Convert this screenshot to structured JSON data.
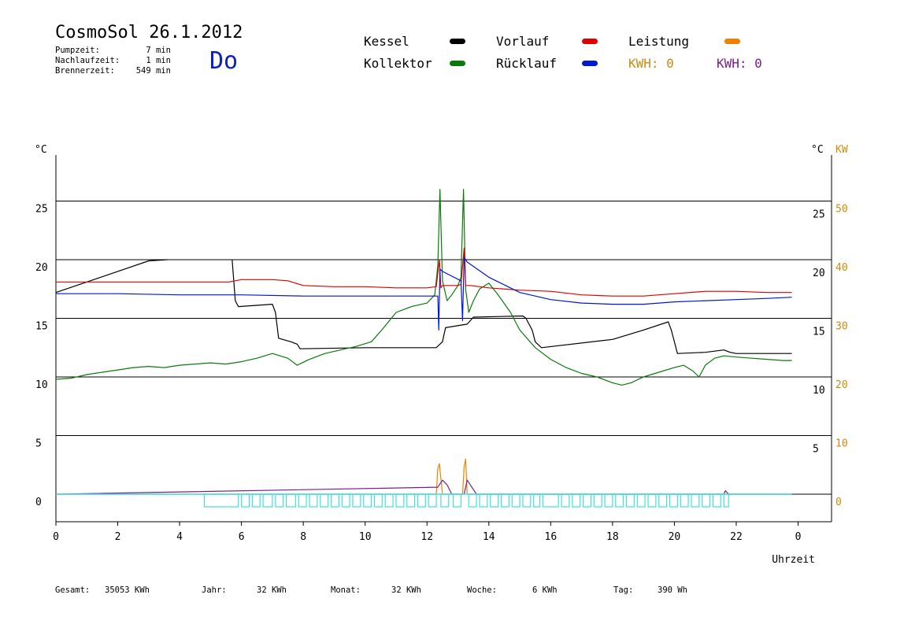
{
  "header": {
    "title": "CosmoSol 26.1.2012",
    "day": "Do",
    "stats": [
      {
        "label": "Pumpzeit:",
        "value": "7 min"
      },
      {
        "label": "Nachlaufzeit:",
        "value": "1 min"
      },
      {
        "label": "Brennerzeit:",
        "value": "549 min"
      }
    ]
  },
  "legend": {
    "kessel": "Kessel",
    "kollektor": "Kollektor",
    "vorlauf": "Vorlauf",
    "ruecklauf": "Rücklauf",
    "leistung": "Leistung",
    "kwh_orange": "KWH: 0",
    "kwh_purple": "KWH: 0"
  },
  "colors": {
    "kessel": "#000000",
    "kollektor": "#0a7a0a",
    "vorlauf": "#e00000",
    "ruecklauf": "#0018d0",
    "leistung": "#f08000",
    "purple": "#7a1e8e",
    "cyan": "#40e0e0",
    "orange_axis": "#d08a10"
  },
  "footer": [
    {
      "label": "Gesamt:",
      "value": "35053 KWh"
    },
    {
      "label": "Jahr:",
      "value": "32 KWh"
    },
    {
      "label": "Monat:",
      "value": "32 KWh"
    },
    {
      "label": "Woche:",
      "value": "6 KWh"
    },
    {
      "label": "Tag:",
      "value": "390 Wh"
    }
  ],
  "chart_data": {
    "type": "line",
    "xlabel": "Uhrzeit",
    "x_ticks": [
      "0",
      "2",
      "4",
      "6",
      "8",
      "10",
      "12",
      "14",
      "16",
      "18",
      "20",
      "22",
      "0"
    ],
    "xlim": [
      0,
      24
    ],
    "left_axis": {
      "unit": "°C",
      "ticks": [
        0,
        5,
        10,
        15,
        20,
        25
      ],
      "ylim": [
        -2.3,
        29
      ]
    },
    "right_axis": {
      "unit": "°C",
      "unit2": "KW",
      "ticks_c": [
        5,
        10,
        15,
        20,
        25
      ],
      "ticks_kw": [
        0,
        10,
        20,
        30,
        40,
        50
      ]
    },
    "series": [
      {
        "name": "Kessel",
        "color_key": "kessel",
        "x": [
          0,
          1,
          2,
          3,
          3.6,
          3.6,
          5.7,
          5.8,
          5.9,
          7.0,
          7.1,
          7.2,
          7.6,
          7.8,
          7.9,
          10,
          12.3,
          12.5,
          12.6,
          13.3,
          13.5,
          15.1,
          15.2,
          15.4,
          15.5,
          15.7,
          18,
          19,
          19.8,
          19.9,
          20.1,
          21,
          21.6,
          21.8,
          22,
          23.8
        ],
        "y": [
          17.2,
          18.1,
          19.0,
          19.9,
          20.0,
          null,
          20.0,
          16.5,
          16.0,
          16.2,
          15.5,
          13.3,
          13.0,
          12.8,
          12.4,
          12.5,
          12.5,
          13.0,
          14.2,
          14.5,
          15.1,
          15.2,
          15.0,
          14.0,
          13.0,
          12.5,
          13.2,
          14.0,
          14.7,
          14.0,
          12.0,
          12.1,
          12.3,
          12.1,
          12.0,
          12.0
        ]
      },
      {
        "name": "Kollektor",
        "color_key": "kollektor",
        "x": [
          0,
          0.5,
          1,
          1.5,
          2,
          2.5,
          3,
          3.5,
          4,
          4.5,
          5,
          5.5,
          6,
          6.5,
          7,
          7.5,
          7.8,
          8.2,
          8.7,
          9.2,
          9.7,
          10.2,
          10.6,
          11,
          11.5,
          12,
          12.25,
          12.35,
          12.42,
          12.5,
          12.65,
          12.8,
          13.0,
          13.1,
          13.18,
          13.25,
          13.35,
          13.5,
          13.7,
          14.0,
          14.3,
          14.7,
          15.0,
          15.5,
          16.0,
          16.5,
          17.0,
          17.5,
          18.0,
          18.3,
          18.6,
          19.0,
          19.5,
          20.0,
          20.3,
          20.6,
          20.8,
          21.0,
          21.3,
          21.6,
          22.0,
          22.5,
          23.0,
          23.5,
          23.8
        ],
        "y": [
          9.8,
          9.9,
          10.2,
          10.4,
          10.6,
          10.8,
          10.9,
          10.8,
          11.0,
          11.1,
          11.2,
          11.1,
          11.3,
          11.6,
          12.0,
          11.6,
          11.0,
          11.5,
          12.0,
          12.3,
          12.6,
          13.0,
          14.2,
          15.5,
          16.0,
          16.3,
          17.0,
          19.5,
          26.0,
          18.2,
          16.5,
          17.0,
          17.8,
          18.5,
          26.0,
          17.5,
          15.5,
          16.5,
          17.5,
          18.0,
          17.0,
          15.5,
          14.0,
          12.5,
          11.5,
          10.8,
          10.3,
          10.0,
          9.5,
          9.3,
          9.5,
          10.0,
          10.4,
          10.8,
          11.0,
          10.5,
          10.0,
          11.0,
          11.6,
          11.8,
          11.7,
          11.6,
          11.5,
          11.4,
          11.4
        ]
      },
      {
        "name": "Vorlauf",
        "color_key": "vorlauf",
        "x": [
          0,
          1,
          2,
          3,
          4,
          5,
          5.6,
          6,
          7,
          7.5,
          8,
          9,
          10,
          11,
          12,
          12.3,
          12.4,
          12.45,
          12.5,
          13,
          13.1,
          13.2,
          13.25,
          13.4,
          14,
          15,
          16,
          17,
          18,
          18.5,
          19,
          20,
          21,
          22,
          23,
          23.8
        ],
        "y": [
          18.1,
          18.1,
          18.1,
          18.1,
          18.1,
          18.1,
          18.1,
          18.3,
          18.3,
          18.2,
          17.8,
          17.7,
          17.7,
          17.6,
          17.6,
          17.7,
          20.0,
          17.6,
          17.8,
          17.8,
          17.9,
          21.0,
          17.8,
          17.8,
          17.6,
          17.4,
          17.3,
          17.0,
          16.9,
          16.9,
          16.9,
          17.1,
          17.3,
          17.3,
          17.2,
          17.2
        ]
      },
      {
        "name": "Rücklauf",
        "color_key": "ruecklauf",
        "x": [
          0,
          2,
          4,
          6,
          8,
          10,
          12,
          12.35,
          12.38,
          12.42,
          12.5,
          13.1,
          13.15,
          13.2,
          13.3,
          14,
          15,
          16,
          17,
          18,
          19,
          20,
          21,
          22,
          23,
          23.8
        ],
        "y": [
          17.1,
          17.1,
          17.0,
          17.0,
          16.9,
          16.9,
          16.9,
          16.9,
          14.0,
          19.2,
          19.0,
          18.2,
          14.8,
          20.2,
          19.8,
          18.5,
          17.2,
          16.6,
          16.3,
          16.2,
          16.2,
          16.4,
          16.5,
          16.6,
          16.7,
          16.8
        ]
      },
      {
        "name": "Leistung",
        "color_key": "leistung",
        "x": [
          0,
          12.3,
          12.35,
          12.4,
          12.5,
          13.15,
          13.2,
          13.25,
          13.3,
          23.8
        ],
        "y": [
          0.0,
          0.0,
          2.2,
          2.6,
          0.0,
          0.0,
          2.3,
          3.0,
          0.0,
          0.0
        ]
      },
      {
        "color_key": "purple",
        "x": [
          0,
          12.35,
          12.5,
          12.65,
          12.8,
          13.2,
          13.3,
          13.45,
          13.6,
          21.6,
          21.65,
          21.75,
          23.8
        ],
        "y": [
          0.0,
          0.6,
          1.2,
          0.8,
          0.0,
          0.0,
          1.2,
          0.6,
          0.0,
          0.0,
          0.3,
          0.0,
          0.0
        ]
      },
      {
        "color_key": "cyan",
        "x": [
          0,
          23.8
        ],
        "y": [
          0,
          0
        ]
      }
    ],
    "grid": true
  }
}
